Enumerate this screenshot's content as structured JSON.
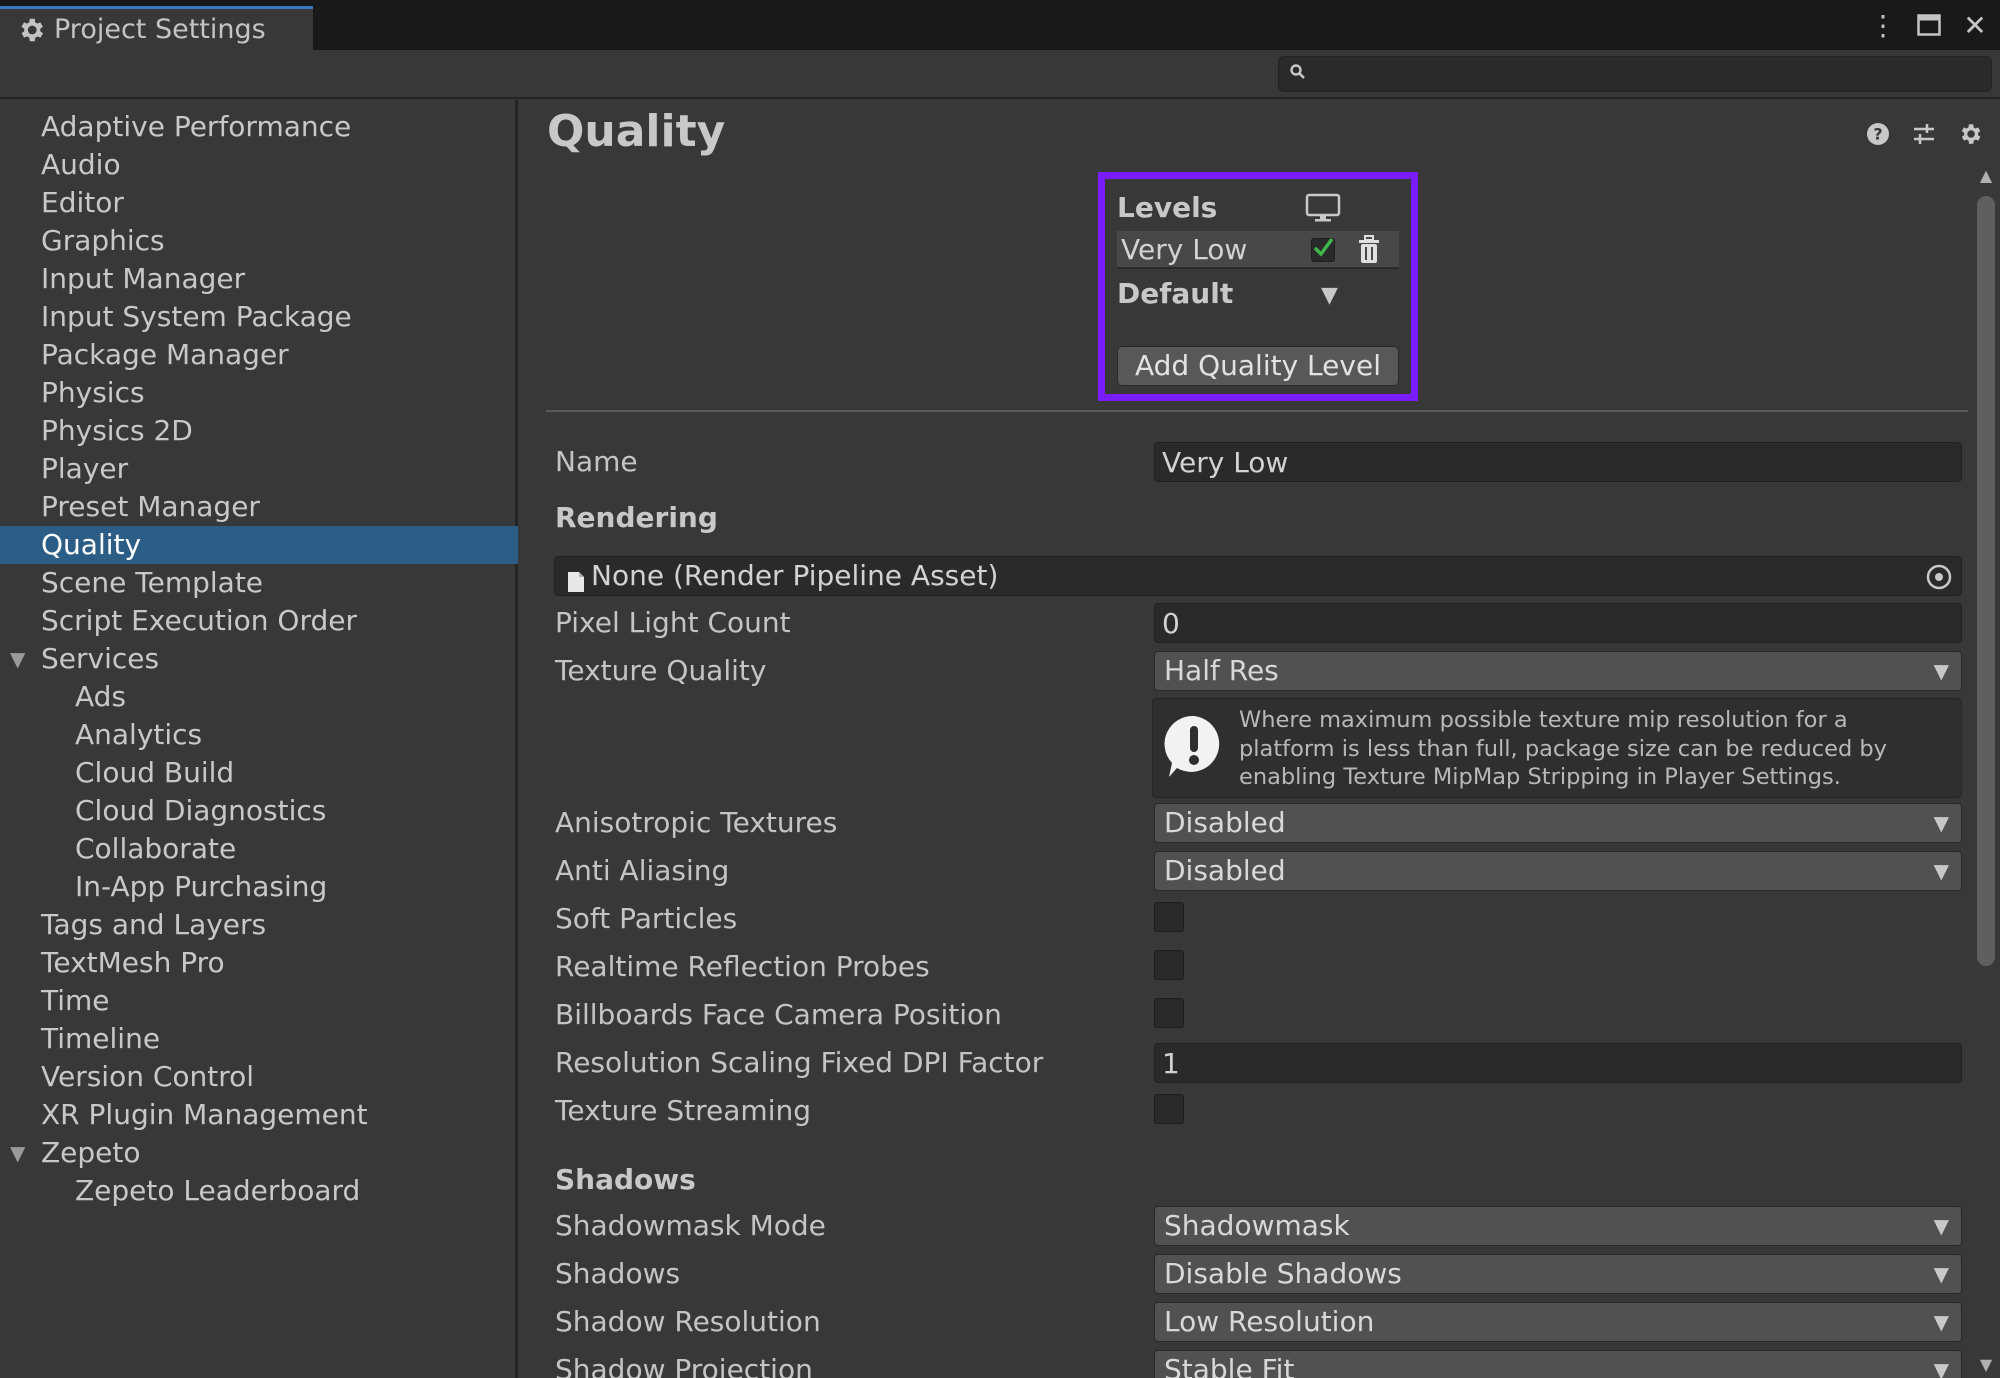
{
  "window": {
    "tab_title": "Project Settings",
    "controls": {
      "menu": "⋮",
      "maximize": "▢",
      "close": "✕"
    }
  },
  "search": {
    "placeholder": "",
    "value": ""
  },
  "sidebar": {
    "items": [
      {
        "label": "Adaptive Performance"
      },
      {
        "label": "Audio"
      },
      {
        "label": "Editor"
      },
      {
        "label": "Graphics"
      },
      {
        "label": "Input Manager"
      },
      {
        "label": "Input System Package"
      },
      {
        "label": "Package Manager"
      },
      {
        "label": "Physics"
      },
      {
        "label": "Physics 2D"
      },
      {
        "label": "Player"
      },
      {
        "label": "Preset Manager"
      },
      {
        "label": "Quality",
        "selected": true
      },
      {
        "label": "Scene Template"
      },
      {
        "label": "Script Execution Order"
      },
      {
        "label": "Services",
        "expanded": true
      },
      {
        "label": "Ads",
        "indent": 1
      },
      {
        "label": "Analytics",
        "indent": 1
      },
      {
        "label": "Cloud Build",
        "indent": 1
      },
      {
        "label": "Cloud Diagnostics",
        "indent": 1
      },
      {
        "label": "Collaborate",
        "indent": 1
      },
      {
        "label": "In-App Purchasing",
        "indent": 1
      },
      {
        "label": "Tags and Layers"
      },
      {
        "label": "TextMesh Pro"
      },
      {
        "label": "Time"
      },
      {
        "label": "Timeline"
      },
      {
        "label": "Version Control"
      },
      {
        "label": "XR Plugin Management"
      },
      {
        "label": "Zepeto",
        "expanded": true
      },
      {
        "label": "Zepeto Leaderboard",
        "indent": 1
      }
    ]
  },
  "main": {
    "title": "Quality",
    "levels": {
      "header": "Levels",
      "level_name": "Very Low",
      "level_enabled": true,
      "default_label": "Default",
      "add_button": "Add Quality Level",
      "highlight_color": "#7a1cfa"
    },
    "name": {
      "label": "Name",
      "value": "Very Low"
    },
    "rendering": {
      "header": "Rendering",
      "pipeline_asset": "None (Render Pipeline Asset)",
      "pixel_light_count": {
        "label": "Pixel Light Count",
        "value": "0"
      },
      "texture_quality": {
        "label": "Texture Quality",
        "value": "Half Res"
      },
      "help_text": "Where maximum possible texture mip resolution for a platform is less than full, package size can be reduced by enabling Texture MipMap Stripping in Player Settings.",
      "anisotropic": {
        "label": "Anisotropic Textures",
        "value": "Disabled"
      },
      "anti_aliasing": {
        "label": "Anti Aliasing",
        "value": "Disabled"
      },
      "soft_particles": {
        "label": "Soft Particles",
        "checked": false
      },
      "realtime_reflection": {
        "label": "Realtime Reflection Probes",
        "checked": false
      },
      "billboards": {
        "label": "Billboards Face Camera Position",
        "checked": false
      },
      "dpi_factor": {
        "label": "Resolution Scaling Fixed DPI Factor",
        "value": "1"
      },
      "texture_streaming": {
        "label": "Texture Streaming",
        "checked": false
      }
    },
    "shadows": {
      "header": "Shadows",
      "shadowmask_mode": {
        "label": "Shadowmask Mode",
        "value": "Shadowmask"
      },
      "shadows": {
        "label": "Shadows",
        "value": "Disable Shadows"
      },
      "shadow_resolution": {
        "label": "Shadow Resolution",
        "value": "Low Resolution"
      },
      "shadow_projection": {
        "label": "Shadow Projection",
        "value": "Stable Fit"
      }
    }
  },
  "colors": {
    "selection": "#2c5d87",
    "tab_accent": "#3a79bb",
    "check_green": "#3fb64a"
  }
}
